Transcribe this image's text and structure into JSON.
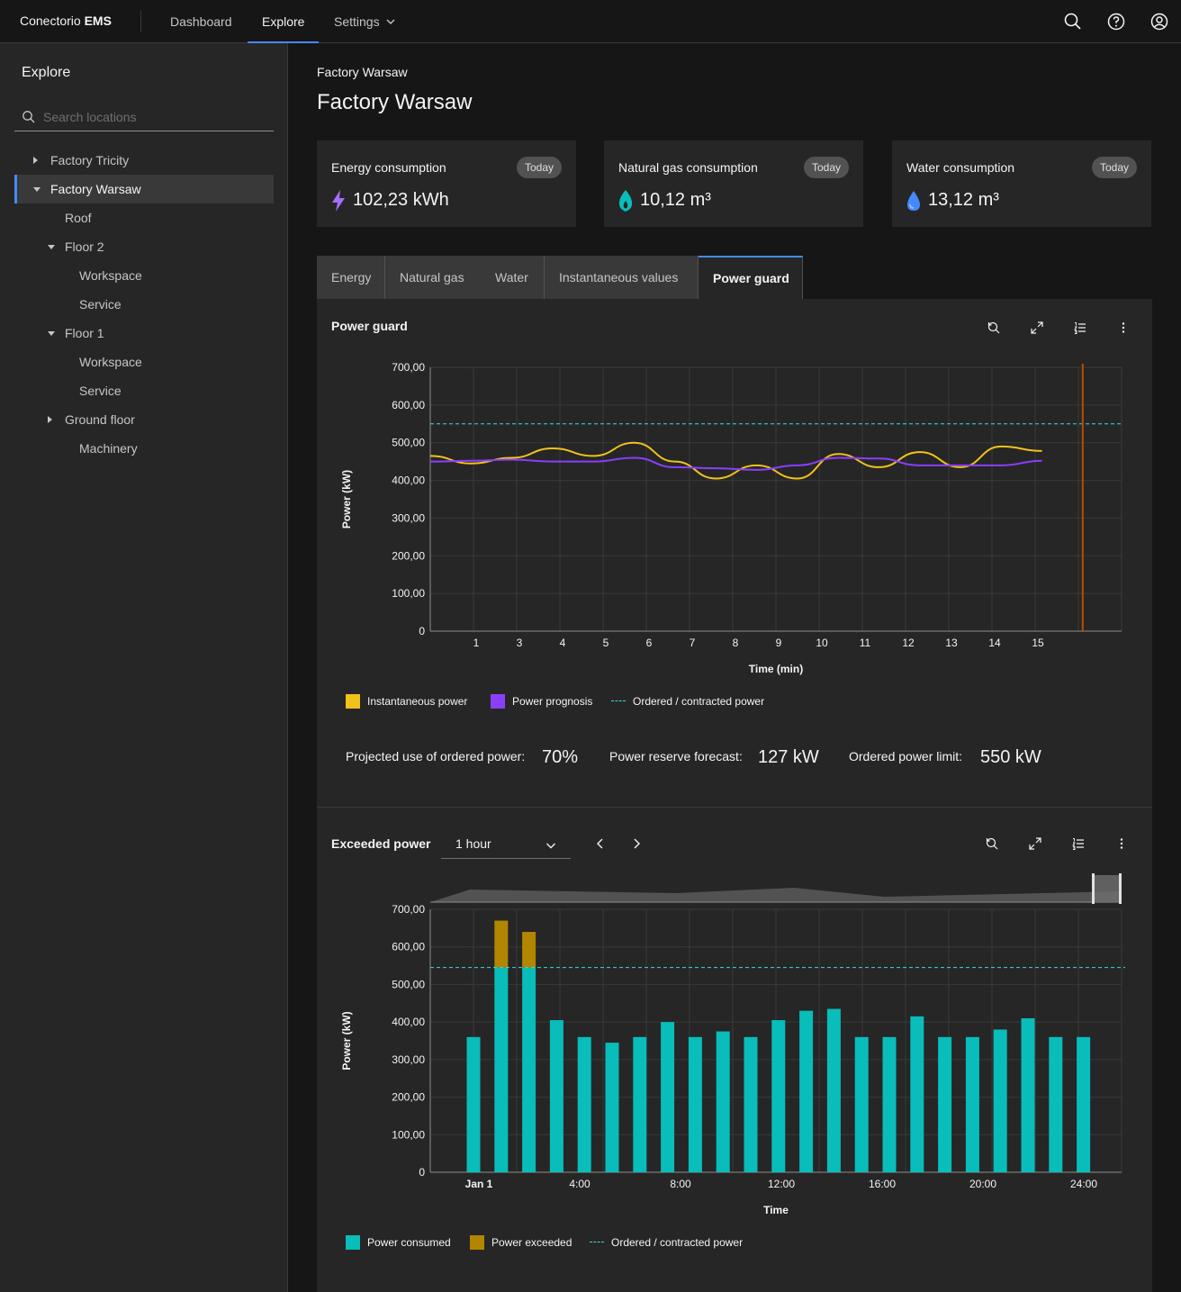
{
  "header": {
    "brand_prefix": "Conectorio",
    "brand_strong": "EMS",
    "nav": [
      {
        "label": "Dashboard"
      },
      {
        "label": "Explore"
      },
      {
        "label": "Settings"
      }
    ],
    "icons": [
      "search-icon",
      "help-icon",
      "user-avatar-icon"
    ]
  },
  "sidebar": {
    "title": "Explore",
    "search_placeholder": "Search locations",
    "tree": [
      {
        "label": "Factory Tricity",
        "level": 0,
        "caret": "right"
      },
      {
        "label": "Factory Warsaw",
        "level": 0,
        "caret": "down",
        "selected": true
      },
      {
        "label": "Roof",
        "level": 1
      },
      {
        "label": "Floor 2",
        "level": 1,
        "caret": "down"
      },
      {
        "label": "Workspace",
        "level": 2
      },
      {
        "label": "Service",
        "level": 2
      },
      {
        "label": "Floor 1",
        "level": 1,
        "caret": "down"
      },
      {
        "label": "Workspace",
        "level": 2
      },
      {
        "label": "Service",
        "level": 2
      },
      {
        "label": "Ground floor",
        "level": 1,
        "caret": "right"
      },
      {
        "label": "Machinery",
        "level": 2
      }
    ]
  },
  "main": {
    "breadcrumb": "Factory Warsaw",
    "title": "Factory Warsaw",
    "kpis": [
      {
        "label": "Energy consumption",
        "tag": "Today",
        "value": "102,23 kWh",
        "icon": "lightning-icon",
        "color": "#a56eff"
      },
      {
        "label": "Natural gas consumption",
        "tag": "Today",
        "value": "10,12 m³",
        "icon": "flame-icon",
        "color": "#08bdba"
      },
      {
        "label": "Water consumption",
        "tag": "Today",
        "value": "13,12 m³",
        "icon": "water-drop-icon",
        "color": "#4589ff"
      }
    ],
    "tabs": [
      {
        "label": "Energy"
      },
      {
        "label": "Natural gas"
      },
      {
        "label": "Water"
      },
      {
        "label": "Instantaneous values"
      },
      {
        "label": "Power guard",
        "active": true
      }
    ],
    "power_guard": {
      "title": "Power guard",
      "toolbar_icons": [
        "reset-zoom-icon",
        "maximize-icon",
        "list-icon",
        "overflow-menu-icon"
      ],
      "stats": [
        {
          "label": "Projected use of ordered power:",
          "value": "70%"
        },
        {
          "label": "Power reserve forecast:",
          "value": "127 kW"
        },
        {
          "label": "Ordered power limit:",
          "value": "550 kW"
        }
      ]
    },
    "exceeded_power": {
      "title": "Exceeded power",
      "range_select": "1 hour",
      "toolbar_icons": [
        "reset-zoom-icon",
        "maximize-icon",
        "list-icon",
        "overflow-menu-icon"
      ]
    }
  },
  "chart_data": [
    {
      "type": "line",
      "title": "",
      "xlabel": "Time (min)",
      "ylabel": "Power (kW)",
      "ylim": [
        0,
        700
      ],
      "yticks": [
        "700,00",
        "600,00",
        "500,00",
        "400,00",
        "300,00",
        "200,00",
        "100,00",
        "0"
      ],
      "xticks": [
        "1",
        "3",
        "4",
        "5",
        "6",
        "7",
        "8",
        "9",
        "10",
        "11",
        "12",
        "13",
        "14",
        "15"
      ],
      "series": [
        {
          "name": "Instantaneous power",
          "color": "#f1c21b",
          "x": [
            0,
            1,
            2,
            3,
            4,
            5,
            6,
            7,
            8,
            9,
            10,
            11,
            12,
            13,
            14,
            15,
            16
          ],
          "values": [
            465,
            445,
            460,
            485,
            465,
            500,
            450,
            405,
            440,
            405,
            470,
            435,
            475,
            435,
            490,
            478,
            null
          ]
        },
        {
          "name": "Power prognosis",
          "color": "#8a3ffc",
          "x": [
            0,
            1,
            2,
            3,
            4,
            5,
            6,
            7,
            8,
            9,
            10,
            11,
            12,
            13,
            14,
            15,
            16
          ],
          "values": [
            450,
            452,
            455,
            450,
            450,
            460,
            435,
            432,
            428,
            440,
            460,
            458,
            440,
            440,
            440,
            452,
            null
          ]
        },
        {
          "name": "Ordered / contracted power",
          "color": "#3ddbd9",
          "dashed": true,
          "values": [
            550
          ]
        }
      ],
      "marker_x": 15.1,
      "marker_color": "#ba4e00",
      "legend": "bottom-left",
      "grid": true
    },
    {
      "type": "bar",
      "title": "",
      "xlabel": "Time",
      "ylabel": "Power (kW)",
      "ylim": [
        0,
        700
      ],
      "yticks": [
        "700,00",
        "600,00",
        "500,00",
        "400,00",
        "300,00",
        "200,00",
        "100,00",
        "0"
      ],
      "xticks": [
        "Jan 1",
        "4:00",
        "8:00",
        "12:00",
        "16:00",
        "20:00",
        "24:00"
      ],
      "series": [
        {
          "name": "Power consumed",
          "color": "#08bdba",
          "values": [
            360,
            545,
            545,
            405,
            360,
            345,
            360,
            400,
            360,
            375,
            360,
            405,
            430,
            435,
            360,
            360,
            415,
            360,
            360,
            380,
            410,
            360,
            360
          ]
        },
        {
          "name": "Power exceeded",
          "color": "#b28600",
          "values": [
            0,
            125,
            95,
            0,
            0,
            0,
            0,
            0,
            0,
            0,
            0,
            0,
            0,
            0,
            0,
            0,
            0,
            0,
            0,
            0,
            0,
            0,
            0
          ]
        },
        {
          "name": "Ordered / contracted power",
          "color": "#3ddbd9",
          "dashed": true,
          "values": [
            545
          ]
        }
      ],
      "legend": "bottom-left",
      "grid": true
    }
  ]
}
